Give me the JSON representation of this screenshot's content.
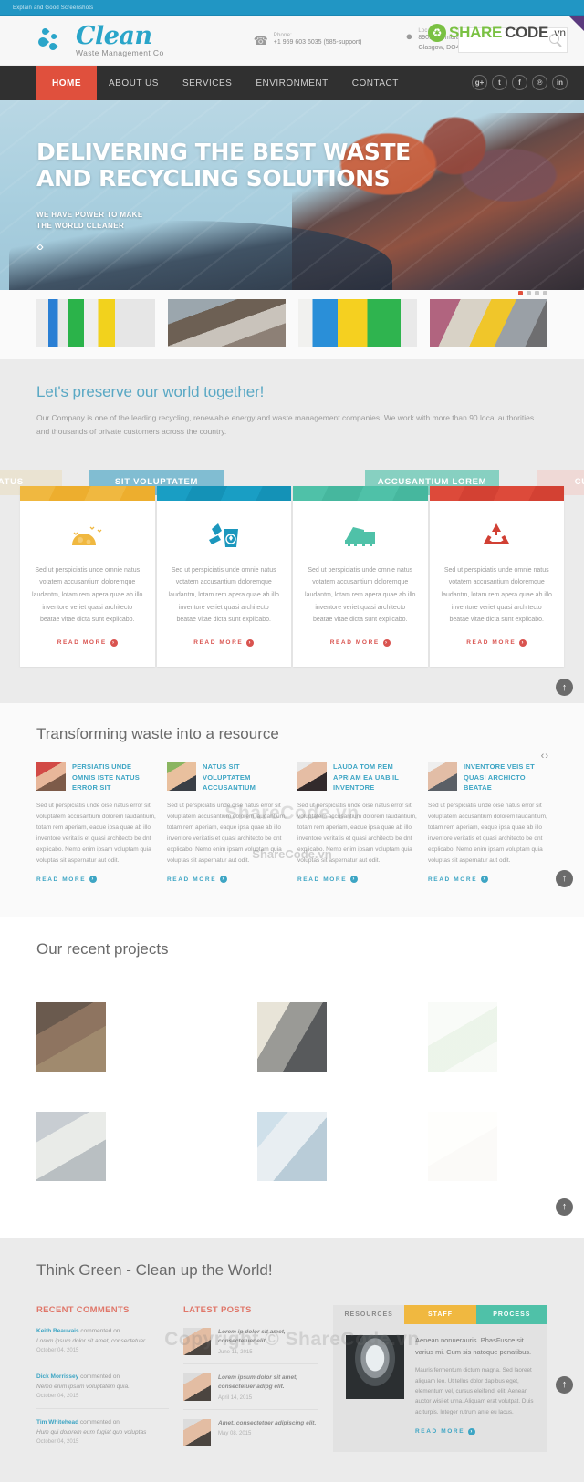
{
  "browser": {
    "strip_text": "Explain and Good Screenshots"
  },
  "header": {
    "logo_name": "Clean",
    "logo_sub": "Waste Management Co",
    "phone_label": "Phone:",
    "phone_value": "+1 959 603 6035 (585-support)",
    "location_label": "Location:",
    "location_value": "8901 Marmora Road,\nGlasgow, DO4 89GR.",
    "location_line1": "8901 Marmora Road,",
    "location_line2": "Glasgow, DO4 89GR.",
    "search_placeholder": "",
    "phone_icon": "phone-icon",
    "pin_icon": "map-pin-icon",
    "search_icon": "search-icon"
  },
  "watermark": {
    "brand_part1": "SHARE",
    "brand_part2": "CODE",
    "brand_part3": ".vn",
    "center_big": "Copyright © ShareCode.vn",
    "center_small": "ShareCode.vn"
  },
  "nav": {
    "items": [
      {
        "label": "HOME",
        "active": true
      },
      {
        "label": "ABOUT US",
        "active": false
      },
      {
        "label": "SERVICES",
        "active": false
      },
      {
        "label": "ENVIRONMENT",
        "active": false
      },
      {
        "label": "CONTACT",
        "active": false
      }
    ],
    "socials": [
      {
        "name": "google-plus-icon",
        "glyph": "g+"
      },
      {
        "name": "twitter-icon",
        "glyph": "t"
      },
      {
        "name": "facebook-icon",
        "glyph": "f"
      },
      {
        "name": "pinterest-icon",
        "glyph": "℗"
      },
      {
        "name": "linkedin-icon",
        "glyph": "in"
      }
    ]
  },
  "hero": {
    "headline_line1": "DELIVERING THE BEST WASTE",
    "headline_line2": "AND RECYCLING SOLUTIONS",
    "sub_line1": "WE HAVE POWER TO MAKE",
    "sub_line2": "THE WORLD CLEANER",
    "prev_next": "‹›"
  },
  "thumbs": {
    "items": [
      {
        "alt": "recycling-bins-thumb"
      },
      {
        "alt": "landfill-loader-thumb"
      },
      {
        "alt": "colored-containers-thumb"
      },
      {
        "alt": "garbage-trucks-thumb"
      }
    ],
    "dots": [
      true,
      false,
      false,
      false
    ]
  },
  "intro": {
    "heading": "Let's preserve our world together!",
    "paragraph": "Our Company is one of the leading recycling, renewable energy and waste management companies. We work with more than 90 local authorities and thousands of private customers across the country."
  },
  "services": {
    "tooltips": [
      {
        "label": "RATUS",
        "color": "#eae3d2"
      },
      {
        "label": "SIT VOLUPTATEM",
        "color": "#81bdd2"
      },
      {
        "label": "ACCUSANTIUM LOREM",
        "color": "#87d0c1"
      },
      {
        "label": "CUSTO",
        "color": "#efd9d6"
      }
    ],
    "body_text": "Sed ut perspiciatis unde omnie natus votatem accusantium doloremque laudantm, lotam rem apera quae ab illo inventore veriet quasi architecto beatae vitae dicta sunt explicabo.",
    "read_more": "READ MORE",
    "cards": [
      {
        "icon": "waste-pile-icon",
        "color": "#f0b840"
      },
      {
        "icon": "bin-broom-icon",
        "color": "#199ec4"
      },
      {
        "icon": "garbage-truck-icon",
        "color": "#4fc1a8"
      },
      {
        "icon": "recycle-icon",
        "color": "#dd4a3a"
      }
    ]
  },
  "team": {
    "heading": "Transforming waste into a resource",
    "read_more": "READ MORE",
    "body_text": "Sed ut perspiciatis unde oise natus error sit voluptatem accusantium dolorem laudantium, totam rem aperiam, eaque ipsa quae ab illo inventore veritatis et quasi architecto be dnt explicabo. Nemo enim ipsam voluptam quia voluptas sit aspernatur aut odit.",
    "members": [
      {
        "name": "PERSIATIS UNDE OMNIS ISTE NATUS ERROR SIT",
        "photo": "worker-helmet-photo"
      },
      {
        "name": "NATUS SIT VOLUPTATEM ACCUSANTIUM",
        "photo": "smiling-man-photo"
      },
      {
        "name": "LAUDA TOM REM APRIAM EA UAB IL INVENTORE",
        "photo": "smiling-woman-photo"
      },
      {
        "name": "INVENTORE VEIS ET QUASI ARCHICTO BEATAE",
        "photo": "businessman-photo"
      }
    ]
  },
  "projects": {
    "heading": "Our recent projects",
    "items": [
      {
        "alt": "scrap-grabber-project"
      },
      {
        "alt": "loader-machine-project"
      },
      {
        "alt": "green-earth-hands-project"
      },
      {
        "alt": "paper-waste-project"
      },
      {
        "alt": "metal-duct-project"
      },
      {
        "alt": "faded-project"
      }
    ]
  },
  "green": {
    "heading": "Think Green - Clean up the World!",
    "comments_title": "RECENT COMMENTS",
    "posts_title": "LATEST POSTS",
    "comments": [
      {
        "author": "Keith Beauvais",
        "action": "commented on",
        "text": "Lorem ipsum dolor sit amet, consectetuer",
        "date": "October 04, 2015"
      },
      {
        "author": "Dick Morrissey",
        "action": "commented on",
        "text": "Nemo enim ipsam voluptatem quia.",
        "date": "October 04, 2015"
      },
      {
        "author": "Tim Whitehead",
        "action": "commented on",
        "text": "Hum qui dolorem eum fugiat quo voluptas",
        "date": "October 04, 2015"
      }
    ],
    "posts": [
      {
        "title": "Lorem ip dolor sit amet, consectetuer elit.",
        "date": "June 11, 2015"
      },
      {
        "title": "Lorem ipsum dolor sit amet, consectetuer adipg elit.",
        "date": "April 14, 2015"
      },
      {
        "title": "Amet, consectetuer adipiscing elit.",
        "date": "May 08, 2015"
      }
    ],
    "tabs": [
      {
        "label": "RESOURCES",
        "state": "active"
      },
      {
        "label": "STAFF",
        "state": "staff"
      },
      {
        "label": "PROCESS",
        "state": "process"
      }
    ],
    "panel": {
      "image": "light-bulb-image",
      "lead": "Aenean nonuerauris. PhasFusce sit varius mi. Cum sis natoque penatibus.",
      "body": "Mauris fermentum dictum magna. Sed laoreet aliquam leo. Ut tellus dolor dapibus eget, elementum vel, cursus eleifend, elit. Aenean auctor wisi et urna. Aliquam erat volutpat. Duis ac turpis. Integer rutrum ante eu lacus.",
      "read_more": "READ MORE"
    }
  },
  "scroll_top": {
    "icon": "arrow-up-icon",
    "glyph": "↑"
  }
}
